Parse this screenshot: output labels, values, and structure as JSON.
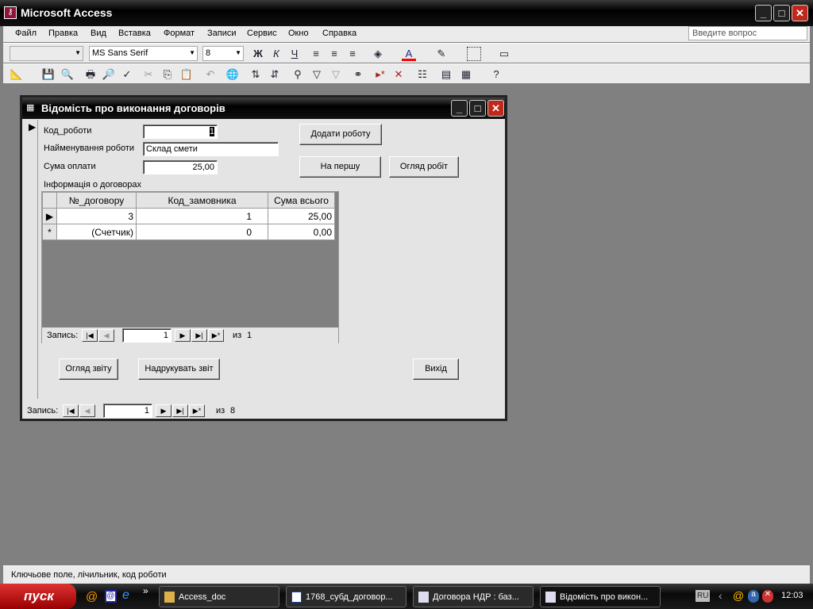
{
  "app": {
    "title": "Microsoft Access"
  },
  "menu": [
    "Файл",
    "Правка",
    "Вид",
    "Вставка",
    "Формат",
    "Записи",
    "Сервис",
    "Окно",
    "Справка"
  ],
  "help_placeholder": "Введите вопрос",
  "toolbar": {
    "font": "MS Sans Serif",
    "size": "8",
    "bold": "Ж",
    "italic": "К",
    "underline": "Ч"
  },
  "form": {
    "title": "Відомість про виконання договорів",
    "labels": {
      "code": "Код_роботи",
      "name": "Найменування роботи",
      "sum": "Сума оплати",
      "info": "Інформація о договорах"
    },
    "values": {
      "code": "1",
      "name": "Склад смети",
      "sum": "25,00"
    },
    "buttons": {
      "add": "Додати роботу",
      "first": "На першу",
      "view_works": "Огляд робіт",
      "view_report": "Огляд звіту",
      "print_report": "Надрукувать звіт",
      "exit": "Вихід"
    },
    "subform": {
      "columns": [
        "№_договору",
        "Код_замовника",
        "Сума всього"
      ],
      "rows": [
        [
          "3",
          "1",
          "25,00"
        ],
        [
          "(Счетчик)",
          "0",
          "0,00"
        ]
      ],
      "nav": {
        "label": "Запись:",
        "current": "1",
        "of": "из",
        "total": "1"
      }
    },
    "nav": {
      "label": "Запись:",
      "current": "1",
      "of": "из",
      "total": "8"
    }
  },
  "status": "Ключьове поле, лічильник, код роботи",
  "taskbar": {
    "start": "пуск",
    "tasks": [
      "Access_doc",
      "1768_субд_договор...",
      "Договора НДР : баз...",
      "Відомість про викон..."
    ],
    "lang": "RU",
    "time": "12:03"
  }
}
